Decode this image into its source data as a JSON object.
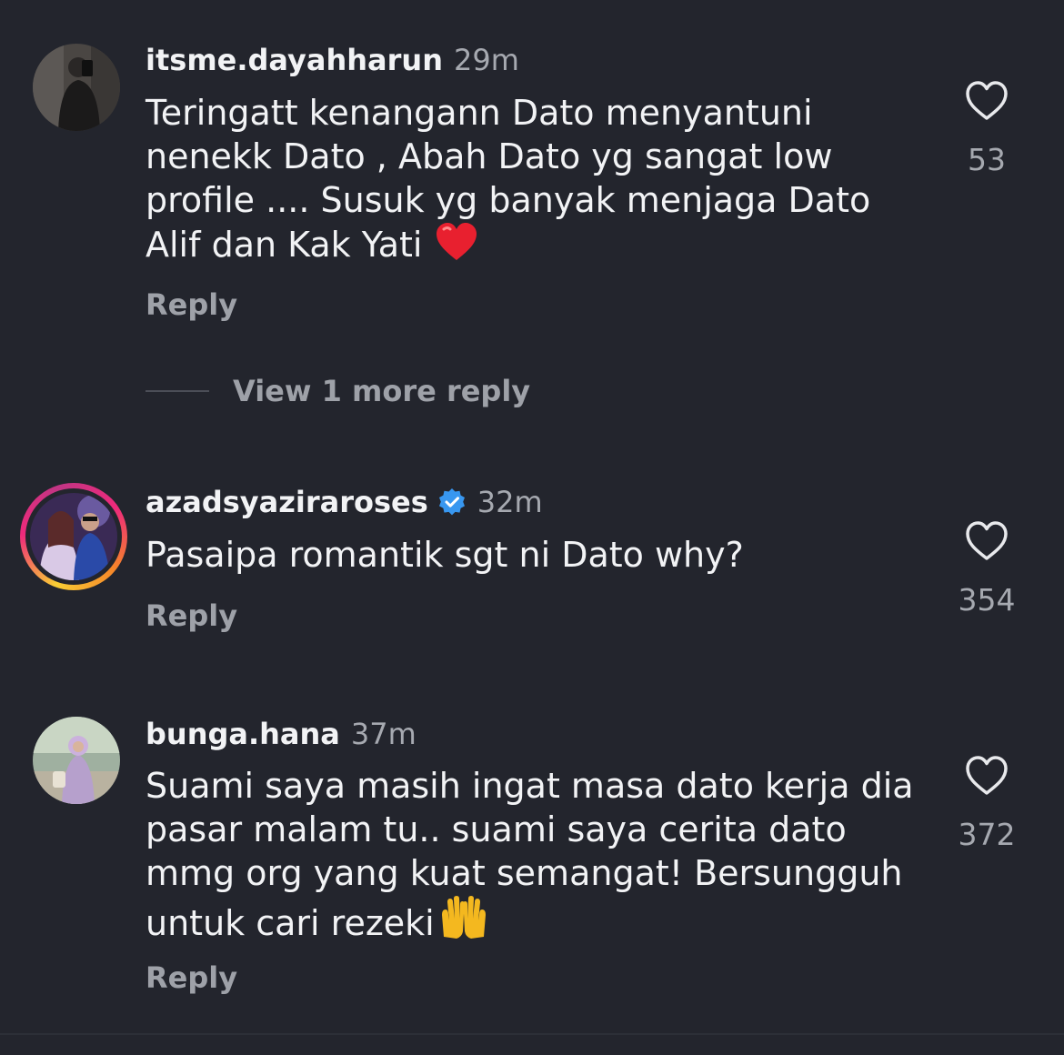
{
  "comments": [
    {
      "username": "itsme.dayahharun",
      "time": "29m",
      "verified": false,
      "text_lines": [
        "Teringatt kenangann Dato menyantuni",
        "nenekk Dato , Abah Dato yg sangat low",
        "profile .... Susuk yg banyak menjaga Dato",
        "Alif dan Kak Yati"
      ],
      "trailing_emoji": "red-heart-icon",
      "likes": "53",
      "reply_label": "Reply",
      "view_more": "View 1 more reply"
    },
    {
      "username": "azadsyaziraroses",
      "time": "32m",
      "verified": true,
      "has_story_ring": true,
      "text_lines": [
        "Pasaipa romantik sgt ni Dato why?"
      ],
      "likes": "354",
      "reply_label": "Reply"
    },
    {
      "username": "bunga.hana",
      "time": "37m",
      "verified": false,
      "text_lines": [
        "Suami saya masih ingat masa dato kerja dia",
        "pasar malam tu.. suami saya cerita dato",
        "mmg org yang kuat semangat! Bersungguh",
        "untuk cari rezeki"
      ],
      "trailing_emoji": "raising-hands-icon",
      "likes": "372",
      "reply_label": "Reply"
    }
  ],
  "colors": {
    "background": "#23252d",
    "primary_text": "#f2f3f5",
    "secondary_text": "#a6a9b0",
    "verified_badge": "#3897f0",
    "heart_emoji": "#e8202f"
  }
}
